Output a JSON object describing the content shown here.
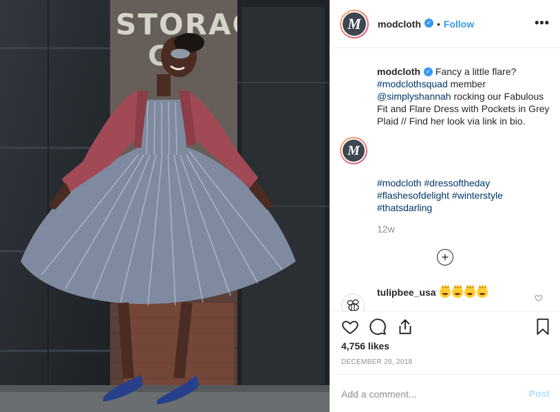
{
  "post": {
    "photo_sign_text": "STORAGE",
    "photo_sign_text2": "CO"
  },
  "header": {
    "avatar_letter": "M",
    "username": "modcloth",
    "verified_icon": "verified-badge-icon",
    "separator": "•",
    "follow_label": "Follow",
    "more_label": "•••"
  },
  "caption": {
    "avatar_letter": "M",
    "username": "modcloth",
    "text_1": "Fancy a little flare?",
    "tag_squad": "#modclothsquad",
    "text_2": "member",
    "mention": "@simplyshannah",
    "text_3": "rocking our Fabulous Fit and Flare Dress with Pockets in Grey Plaid // Find her look via link in bio.",
    "hashtags": [
      "#modcloth",
      "#dressoftheday",
      "#flashesofdelight",
      "#winterstyle",
      "#thatsdarling"
    ],
    "age": "12w"
  },
  "load_more_label": "+",
  "comment": {
    "username": "tulipbee_usa",
    "emoji_icons": [
      "crown-face-emoji",
      "crown-face-emoji",
      "crown-face-emoji",
      "crown-face-emoji"
    ]
  },
  "actions": {
    "icons": [
      "heart-icon",
      "comment-icon",
      "share-icon",
      "bookmark-icon"
    ],
    "likes": "4,756 likes",
    "date": "December 28, 2018"
  },
  "add_comment": {
    "placeholder": "Add a comment...",
    "post_label": "Post"
  },
  "colors": {
    "accent_blue": "#3897f0",
    "link_blue": "#003569",
    "muted_gray": "#8e8e8e",
    "post_disabled": "#b2dffc"
  }
}
